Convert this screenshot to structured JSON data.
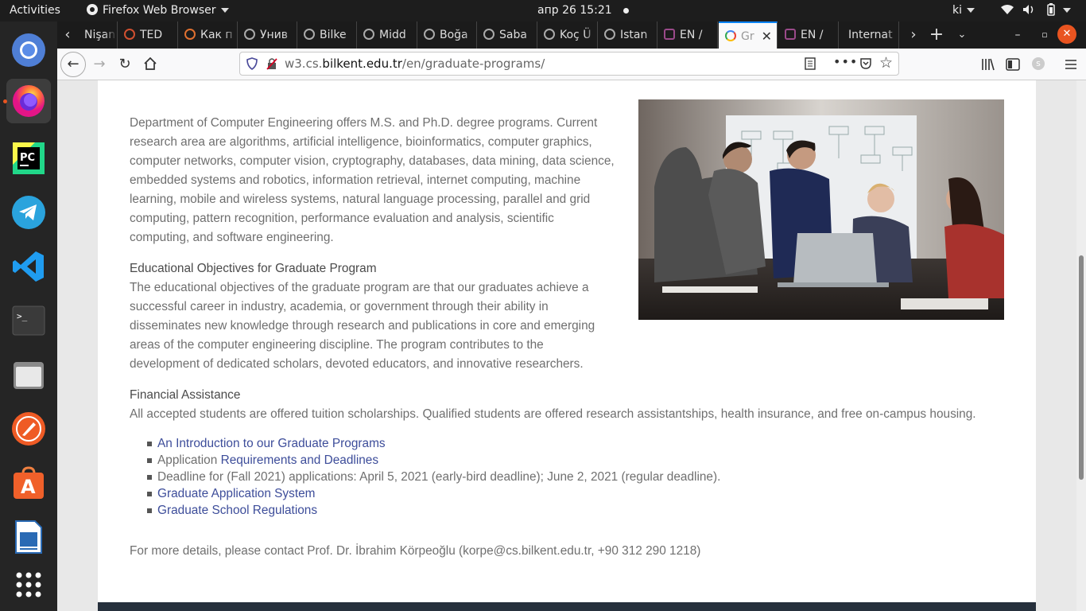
{
  "topbar": {
    "activities": "Activities",
    "app_name": "Firefox Web Browser",
    "clock": "апр 26  15:21",
    "user": "ki"
  },
  "dock": {
    "items": [
      "chromium-icon",
      "firefox-icon",
      "pycharm-icon",
      "telegram-icon",
      "vscode-icon",
      "terminal-icon",
      "files-icon",
      "postman-icon",
      "software-center-icon",
      "libreoffice-impress-icon",
      "app-grid-icon"
    ]
  },
  "tabs": [
    {
      "label": "Nişan"
    },
    {
      "label": "TED"
    },
    {
      "label": "Как п"
    },
    {
      "label": "Унив"
    },
    {
      "label": "Bilke"
    },
    {
      "label": "Midd"
    },
    {
      "label": "Boğa"
    },
    {
      "label": "Saba"
    },
    {
      "label": "Koç Ü"
    },
    {
      "label": "Istan"
    },
    {
      "label": "EN / "
    },
    {
      "label": "Gr"
    },
    {
      "label": "EN / "
    },
    {
      "label": "Internat"
    }
  ],
  "navbar": {
    "url_prefix": "w3.cs.",
    "url_domain": "bilkent.edu.tr",
    "url_path": "/en/graduate-programs/"
  },
  "content": {
    "intro": "Department of Computer Engineering offers M.S. and Ph.D. degree programs. Current research area are algorithms, artificial intelligence, bioinformatics, computer graphics, computer networks, computer vision, cryptography, databases, data mining, data science, embedded systems and robotics, information retrieval, internet computing, machine learning, mobile and wireless systems, natural language processing, parallel and grid computing, pattern recognition, performance evaluation and analysis, scientific computing, and software engineering.",
    "objectives_heading": "Educational Objectives for Graduate Program",
    "objectives_text": "The educational objectives of the graduate program are that our graduates achieve a successful career in industry, academia, or government through their ability in disseminates new knowledge through research and publications in core and emerging areas of the computer engineering discipline. The program contributes to the development of dedicated scholars, devoted educators, and innovative researchers.",
    "financial_heading": "Financial Assistance",
    "financial_text": "All accepted students are offered tuition scholarships. Qualified students are offered research assistantships, health insurance, and free on-campus housing.",
    "links": {
      "intro_link": "An Introduction to our Graduate Programs",
      "application_prefix": "Application ",
      "requirements_link": "Requirements and Deadlines",
      "deadline_text": "Deadline for (Fall 2021) applications: April 5, 2021 (early-bird deadline); June 2, 2021 (regular deadline).",
      "application_system_link": "Graduate Application System",
      "regulations_link": "Graduate School Regulations"
    },
    "contact": "For more details, please contact Prof. Dr. İbrahim Körpeoğlu (korpe@cs.bilkent.edu.tr, +90 312 290 1218)"
  }
}
